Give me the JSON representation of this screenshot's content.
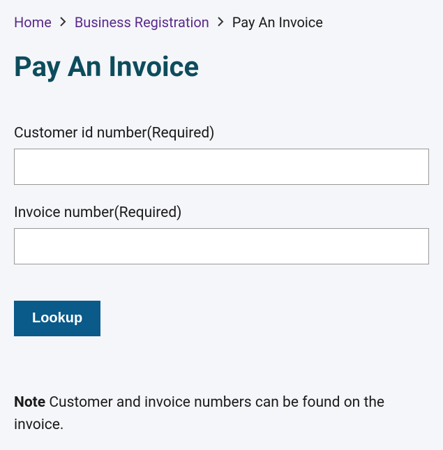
{
  "breadcrumb": {
    "home": "Home",
    "business_registration": "Business Registration",
    "current": "Pay An Invoice"
  },
  "page_title": "Pay An Invoice",
  "form": {
    "customer_id": {
      "label": "Customer id number(Required)",
      "value": ""
    },
    "invoice_number": {
      "label": "Invoice number(Required)",
      "value": ""
    },
    "lookup_label": "Lookup"
  },
  "note": {
    "label": "Note",
    "text": " Customer and invoice numbers can be found on the invoice."
  }
}
